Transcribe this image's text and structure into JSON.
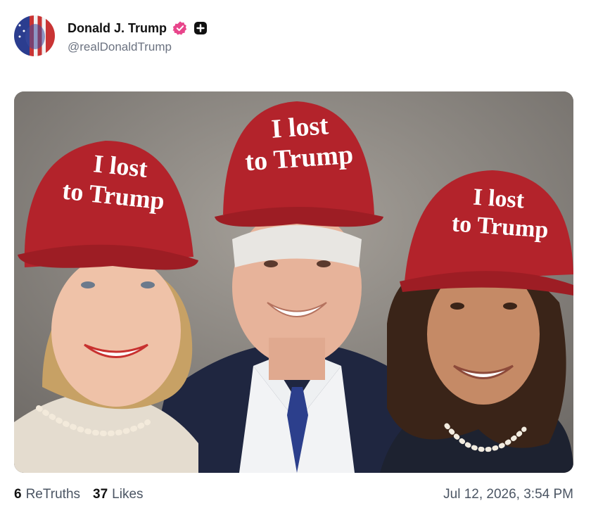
{
  "post": {
    "author": {
      "display_name": "Donald J. Trump",
      "handle": "@realDonaldTrump",
      "verified": true,
      "badge_color": "#e8458b"
    },
    "media": {
      "hat_text_line1": "I lost",
      "hat_text_line2": "to Trump",
      "hat_color": "#b3232b"
    },
    "stats": {
      "retruths_count": "6",
      "retruths_label": "ReTruths",
      "likes_count": "37",
      "likes_label": "Likes"
    },
    "timestamp": "Jul 12, 2026, 3:54 PM"
  }
}
